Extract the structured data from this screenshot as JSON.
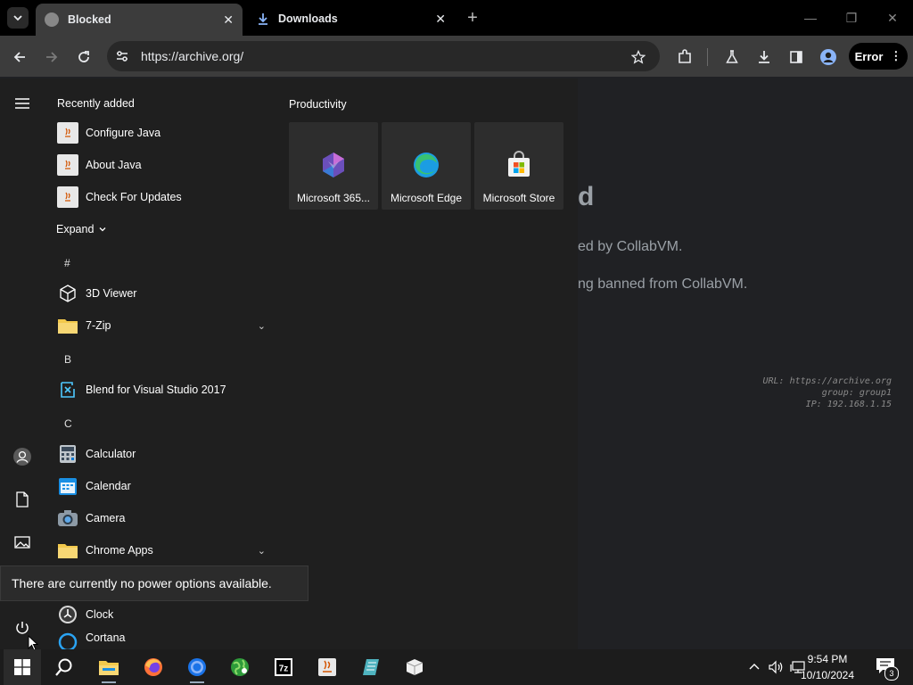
{
  "browser": {
    "tabs": [
      {
        "title": "Blocked",
        "active": true
      },
      {
        "title": "Downloads",
        "active": false
      }
    ],
    "new_tab_label": "+",
    "url": "https://archive.org/",
    "error_label": "Error"
  },
  "blocked_page": {
    "heading_fragment": "d",
    "line1_fragment": "ed by CollabVM.",
    "line2_fragment": "ng banned from CollabVM.",
    "url_line": "URL: https://archive.org",
    "group_line": "group: group1",
    "ip_line": "IP: 192.168.1.15"
  },
  "start_menu": {
    "recently_added_header": "Recently added",
    "recently_added": [
      {
        "label": "Configure Java"
      },
      {
        "label": "About Java"
      },
      {
        "label": "Check For Updates"
      }
    ],
    "expand_label": "Expand",
    "groups": {
      "hash": "#",
      "b": "B",
      "c": "C"
    },
    "apps": [
      {
        "label": "3D Viewer"
      },
      {
        "label": "7-Zip"
      },
      {
        "label": "Blend for Visual Studio 2017"
      },
      {
        "label": "Calculator"
      },
      {
        "label": "Calendar"
      },
      {
        "label": "Camera"
      },
      {
        "label": "Chrome Apps"
      },
      {
        "label": "Clock"
      },
      {
        "label": "Cortana"
      }
    ],
    "productivity_header": "Productivity",
    "tiles": [
      {
        "label": "Microsoft 365..."
      },
      {
        "label": "Microsoft Edge"
      },
      {
        "label": "Microsoft Store"
      }
    ],
    "power_tooltip": "There are currently no power options available."
  },
  "taskbar": {
    "time": "9:54 PM",
    "date": "10/10/2024",
    "notification_count": "3"
  },
  "colors": {
    "accent_blue": "#0078d4",
    "folder_yellow": "#f2c94c"
  }
}
